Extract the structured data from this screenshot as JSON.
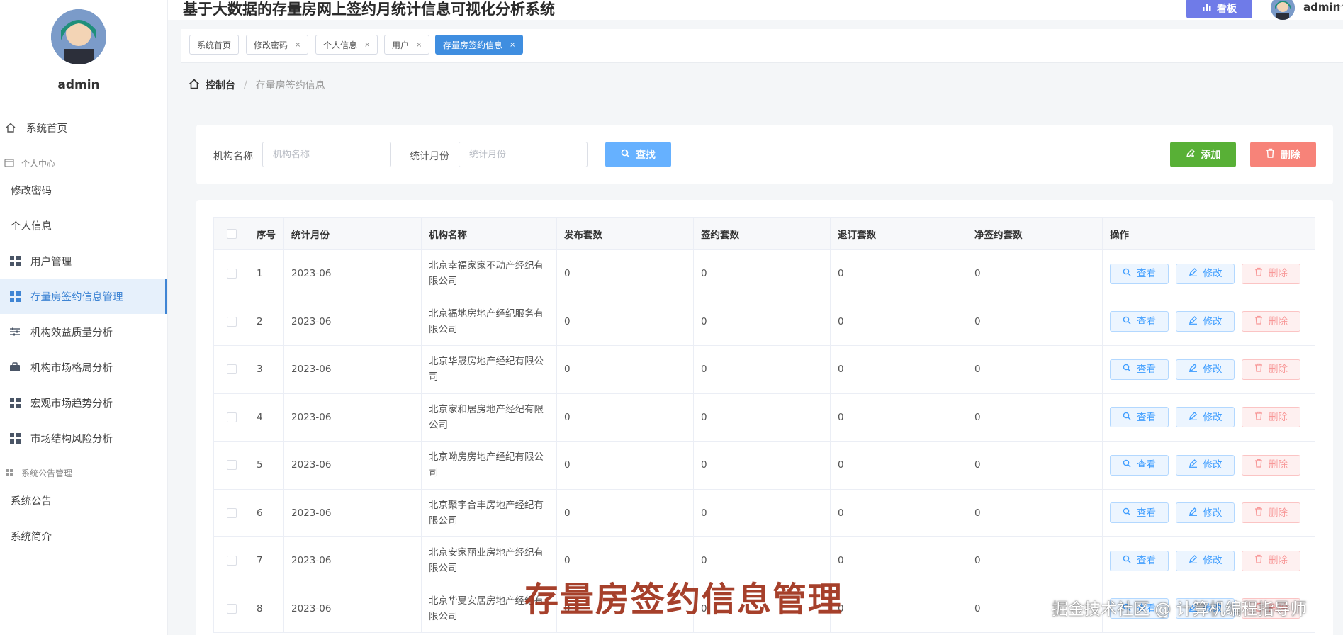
{
  "app": {
    "title": "基于大数据的存量房网上签约月统计信息可视化分析系统"
  },
  "header": {
    "board_label": "看板",
    "username": "admin",
    "caret": "﹀"
  },
  "sidebar": {
    "username": "admin",
    "items": [
      {
        "label": "系统首页",
        "icon": "home-icon"
      },
      {
        "label": "个人中心",
        "icon": "card-icon",
        "group": true
      },
      {
        "label": "修改密码"
      },
      {
        "label": "个人信息"
      },
      {
        "label": "用户管理",
        "icon": "grid-icon"
      },
      {
        "label": "存量房签约信息管理",
        "icon": "grid-icon",
        "active": true
      },
      {
        "label": "机构效益质量分析",
        "icon": "sliders-icon"
      },
      {
        "label": "机构市场格局分析",
        "icon": "briefcase-icon"
      },
      {
        "label": "宏观市场趋势分析",
        "icon": "grid-icon"
      },
      {
        "label": "市场结构风险分析",
        "icon": "grid-icon"
      },
      {
        "label": "系统公告管理",
        "icon": "grid-icon",
        "group": true
      },
      {
        "label": "系统公告"
      },
      {
        "label": "系统简介"
      }
    ]
  },
  "tags": [
    {
      "label": "系统首页",
      "closable": false
    },
    {
      "label": "修改密码",
      "closable": true
    },
    {
      "label": "个人信息",
      "closable": true
    },
    {
      "label": "用户",
      "closable": true
    },
    {
      "label": "存量房签约信息",
      "closable": true,
      "active": true
    }
  ],
  "tag_close": "×",
  "breadcrumb": {
    "home": "控制台",
    "separator": "/",
    "current": "存量房签约信息"
  },
  "search": {
    "org_label": "机构名称",
    "org_placeholder": "机构名称",
    "month_label": "统计月份",
    "month_placeholder": "统计月份",
    "search_button": "查找",
    "add_button": "添加",
    "delete_button": "删除"
  },
  "table": {
    "columns": [
      "序号",
      "统计月份",
      "机构名称",
      "发布套数",
      "签约套数",
      "退订套数",
      "净签约套数",
      "操作"
    ],
    "rows": [
      {
        "no": "1",
        "month": "2023-06",
        "org": "北京幸福家家不动产经纪有限公司",
        "published": "0",
        "signed": "0",
        "cancelled": "0",
        "net": "0"
      },
      {
        "no": "2",
        "month": "2023-06",
        "org": "北京福地房地产经纪服务有限公司",
        "published": "0",
        "signed": "0",
        "cancelled": "0",
        "net": "0"
      },
      {
        "no": "3",
        "month": "2023-06",
        "org": "北京华晟房地产经纪有限公司",
        "published": "0",
        "signed": "0",
        "cancelled": "0",
        "net": "0"
      },
      {
        "no": "4",
        "month": "2023-06",
        "org": "北京家和居房地产经纪有限公司",
        "published": "0",
        "signed": "0",
        "cancelled": "0",
        "net": "0"
      },
      {
        "no": "5",
        "month": "2023-06",
        "org": "北京呦房房地产经纪有限公司",
        "published": "0",
        "signed": "0",
        "cancelled": "0",
        "net": "0"
      },
      {
        "no": "6",
        "month": "2023-06",
        "org": "北京聚宇合丰房地产经纪有限公司",
        "published": "0",
        "signed": "0",
        "cancelled": "0",
        "net": "0"
      },
      {
        "no": "7",
        "month": "2023-06",
        "org": "北京安家丽业房地产经纪有限公司",
        "published": "0",
        "signed": "0",
        "cancelled": "0",
        "net": "0"
      },
      {
        "no": "8",
        "month": "2023-06",
        "org": "北京华夏安居房地产经纪有限公司",
        "published": "0",
        "signed": "0",
        "cancelled": "0",
        "net": "0"
      }
    ],
    "actions": {
      "view": "查看",
      "edit": "修改",
      "delete": "删除"
    }
  },
  "overlay": {
    "title": "存量房签约信息管理",
    "watermark": "掘金技术社区 @ 计算机编程指导师"
  },
  "colors": {
    "primary": "#409eff",
    "menu_active": "#3f85d4",
    "board_button": "#6f7be8",
    "add_button": "#58b036",
    "delete_button": "#f78379",
    "search_button": "#66b1ff",
    "overlay_title": "#a23620"
  }
}
